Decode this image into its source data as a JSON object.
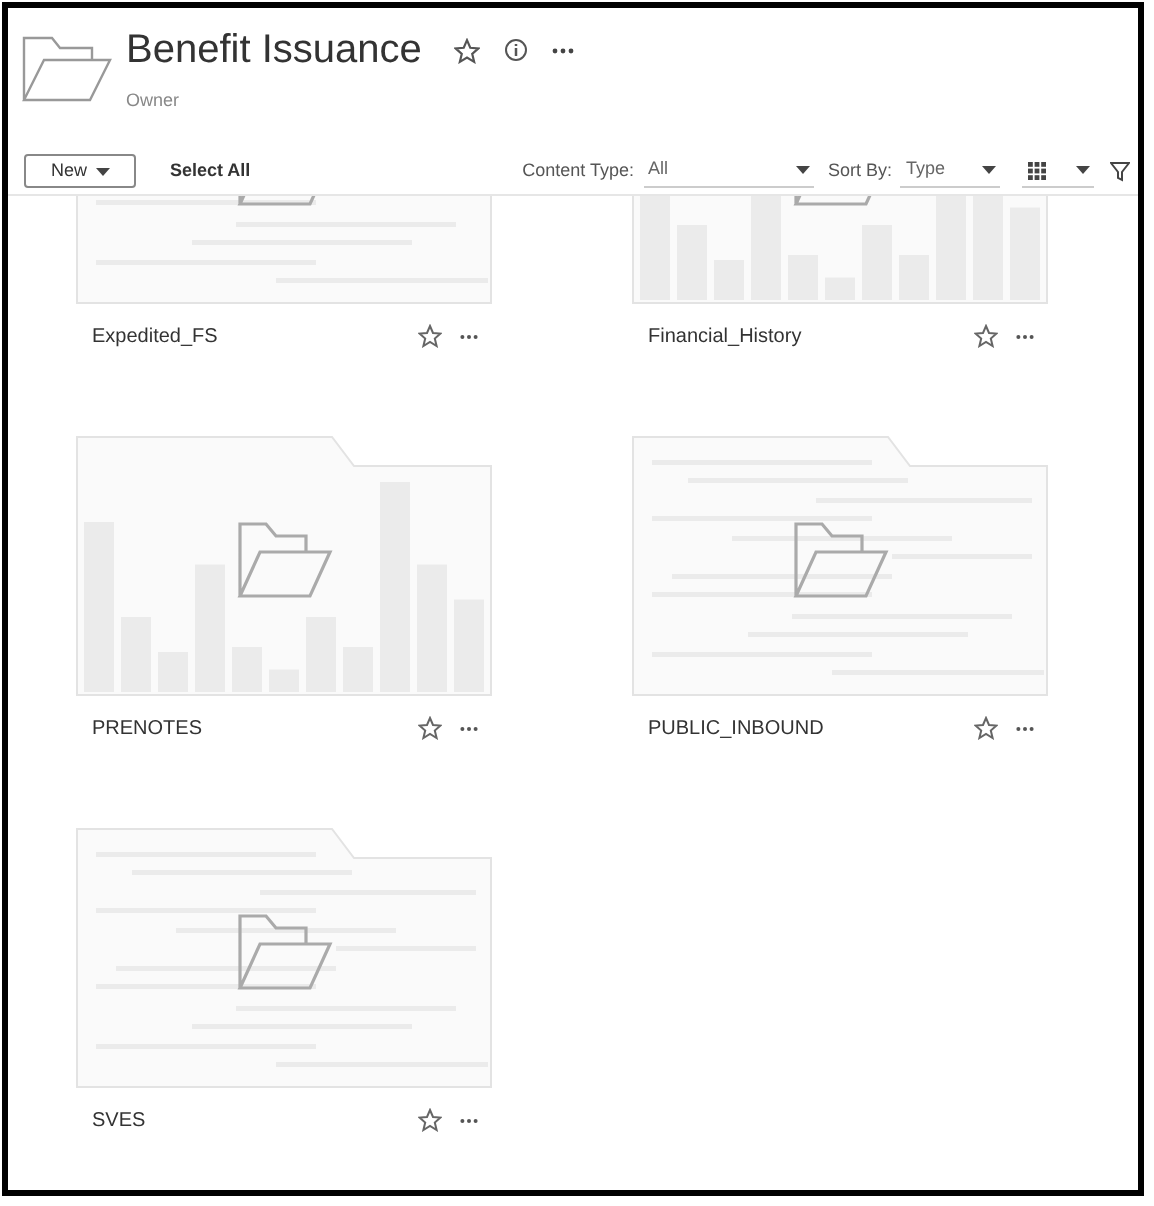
{
  "header": {
    "title": "Benefit Issuance",
    "subtitle": "Owner"
  },
  "toolbar": {
    "new_button": "New",
    "select_all": "Select All",
    "content_type": {
      "label": "Content Type:",
      "value": "All"
    },
    "sort_by": {
      "label": "Sort By:",
      "value": "Type"
    }
  },
  "items": [
    {
      "name": "Expedited_FS",
      "kind": "lines"
    },
    {
      "name": "Financial_History",
      "kind": "bars"
    },
    {
      "name": "PRENOTES",
      "kind": "bars"
    },
    {
      "name": "PUBLIC_INBOUND",
      "kind": "lines"
    },
    {
      "name": "SVES",
      "kind": "lines"
    }
  ]
}
